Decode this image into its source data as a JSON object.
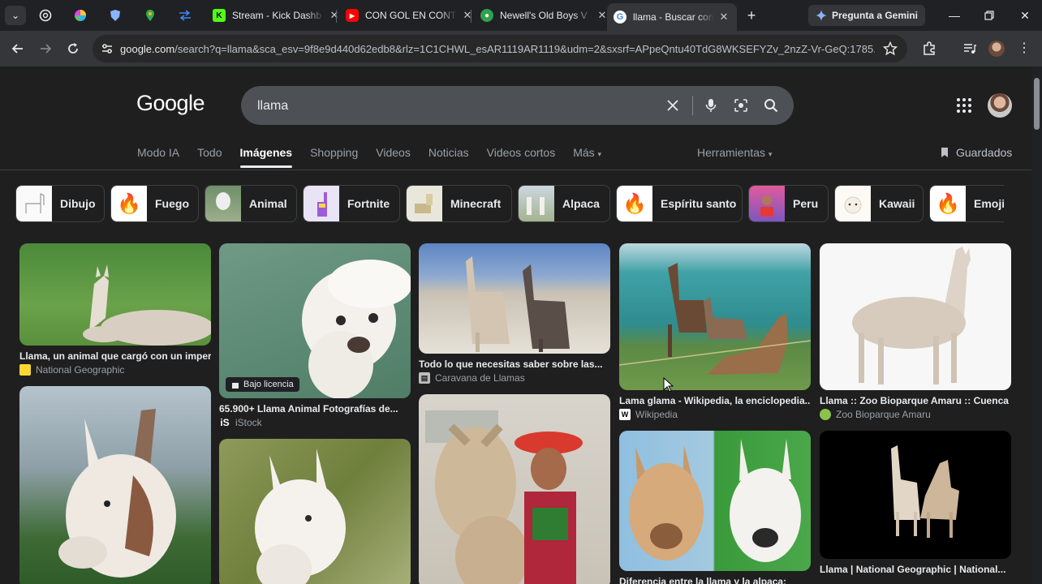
{
  "tabs": [
    {
      "title": "Stream - Kick Dashb",
      "favicon": "K",
      "color": "#53fc18"
    },
    {
      "title": "CON GOL EN CONT",
      "favicon": "▶",
      "color": "#ff0000"
    },
    {
      "title": "Newell's Old Boys V",
      "favicon": "●",
      "color": "#30a14e"
    },
    {
      "title": "llama - Buscar con G",
      "favicon": "G",
      "color": "#ffffff"
    }
  ],
  "gemini_label": "Pregunta a Gemini",
  "url": {
    "host": "google.com",
    "path": "/search?q=llama&sca_esv=9f8e9d440d62edb8&rlz=1C1CHWL_esAR1119AR1119&udm=2&sxsrf=APpeQntu40TdG8WKSEFYZv_2nzZ-Vr-GeQ:1785..."
  },
  "logo": "Google",
  "search": {
    "value": "llama"
  },
  "nav_tabs": [
    "Modo IA",
    "Todo",
    "Imágenes",
    "Shopping",
    "Videos",
    "Noticias",
    "Videos cortos",
    "Más"
  ],
  "selected_tab": "Imágenes",
  "tools_label": "Herramientas",
  "saved_label": "Guardados",
  "chips": [
    "Dibujo",
    "Fuego",
    "Animal",
    "Fortnite",
    "Minecraft",
    "Alpaca",
    "Espíritu santo",
    "Peru",
    "Kawaii",
    "Emoji"
  ],
  "results": [
    {
      "caption": "Llama, un animal que cargó con un imperio",
      "source": "National Geographic"
    },
    {
      "caption": "65.900+ Llama Animal Fotografías de...",
      "source": "iStock",
      "badge": "Bajo licencia"
    },
    {
      "caption": "Todo lo que necesitas saber sobre las...",
      "source": "Caravana de Llamas"
    },
    {
      "caption": "Lama glama - Wikipedia, la enciclopedia...",
      "source": "Wikipedia"
    },
    {
      "caption": "Llama :: Zoo Bioparque Amaru :: Cuenca -...",
      "source": "Zoo Bioparque Amaru"
    },
    {
      "caption": "Llama | National Geographic | National...",
      "source": "National Geographic"
    },
    {
      "caption": "Diferencia entre la llama y la alpaca:",
      "source": ""
    }
  ],
  "colors": {
    "bg": "#1f1f1f",
    "searchbox": "#4d5156",
    "tabstrip": "#202124",
    "toolbar": "#35363a"
  }
}
